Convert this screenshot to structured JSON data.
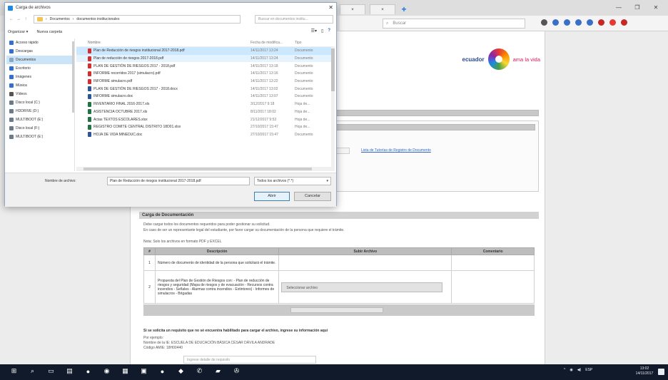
{
  "dialog": {
    "title": "Carga de archivos",
    "path": [
      "Documentos",
      "documentos institucionales"
    ],
    "search_placeholder": "Buscar en documentos institu...",
    "toolbar": {
      "organize": "Organizar ▾",
      "new_folder": "Nueva carpeta"
    },
    "nav_items": [
      {
        "label": "Acceso rápido",
        "icon": "star-icon",
        "color": "#2f6fd6"
      },
      {
        "label": "Descargas",
        "icon": "download-icon",
        "color": "#2f6fd6"
      },
      {
        "label": "Documentos",
        "icon": "documents-icon",
        "color": "#8aa6c8"
      },
      {
        "label": "Escritorio",
        "icon": "desktop-icon",
        "color": "#2f6fd6"
      },
      {
        "label": "Imágenes",
        "icon": "pictures-icon",
        "color": "#2f6fd6"
      },
      {
        "label": "Música",
        "icon": "music-icon",
        "color": "#2f6fd6"
      },
      {
        "label": "Vídeos",
        "icon": "videos-icon",
        "color": "#555555"
      },
      {
        "label": "Disco local (C:)",
        "icon": "drive-icon",
        "color": "#6b7b8c"
      },
      {
        "label": "HDDRIVE (D:)",
        "icon": "drive-icon",
        "color": "#6b7b8c"
      },
      {
        "label": "MULTIBOOT (E:)",
        "icon": "usb-icon",
        "color": "#6b7b8c"
      },
      {
        "label": "Disco local (F:)",
        "icon": "drive-icon",
        "color": "#6b7b8c"
      },
      {
        "label": "MULTIBOOT (E:)",
        "icon": "usb-icon",
        "color": "#6b7b8c"
      }
    ],
    "selected_nav": 2,
    "columns": {
      "name": "Nombre",
      "date": "Fecha de modifica...",
      "type": "Tipo"
    },
    "files": [
      {
        "name": "Plan de Reducción de riesgos institucional 2017-2018.pdf",
        "date": "14/11/2017 13:24",
        "type": "Documento",
        "icon_color": "#d32f2f"
      },
      {
        "name": "Plan de reducción de riesgos 2017-2018.pdf",
        "date": "14/11/2017 13:24",
        "type": "Documento",
        "icon_color": "#d32f2f"
      },
      {
        "name": "PLAN DE GESTIÓN DE RIESGOS 2017 - 2018.pdf",
        "date": "14/11/2017 13:18",
        "type": "Documento",
        "icon_color": "#d32f2f"
      },
      {
        "name": "INFORME recorridos 2017 (simulacro).pdf",
        "date": "14/11/2017 13:16",
        "type": "Documento",
        "icon_color": "#d32f2f"
      },
      {
        "name": "INFORME simulacro.pdf",
        "date": "14/11/2017 13:22",
        "type": "Documento",
        "icon_color": "#d32f2f"
      },
      {
        "name": "PLAN DE GESTIÓN DE RIESGOS 2017 - 2018.docx",
        "date": "14/11/2017 13:02",
        "type": "Documento",
        "icon_color": "#2b579a"
      },
      {
        "name": "INFORME simulacro.doc",
        "date": "14/11/2017 13:07",
        "type": "Documento",
        "icon_color": "#2b579a"
      },
      {
        "name": "INVENTARIO FINAL 2016-2017.xls",
        "date": "3/12/2017 9:18",
        "type": "Hoja de...",
        "icon_color": "#217346"
      },
      {
        "name": "ASISTENCIA OCTUBRE 2017.xls",
        "date": "8/11/2017 18:02",
        "type": "Hoja de...",
        "icon_color": "#217346"
      },
      {
        "name": "Actas TEXTOS ESCOLARES.xlsx",
        "date": "21/12/2017 9:53",
        "type": "Hoja de...",
        "icon_color": "#217346"
      },
      {
        "name": "REGISTRO COMITÉ CENTRAL DISTRITO 18D01.xlsx",
        "date": "27/10/2017 15:47",
        "type": "Hoja de...",
        "icon_color": "#217346"
      },
      {
        "name": "HOJA DE VIDA MINEDUC.doc",
        "date": "27/10/2017 15:47",
        "type": "Documento",
        "icon_color": "#2b579a"
      }
    ],
    "selected_file": 0,
    "hover_file": 1,
    "file_name_label": "Nombre de archivo:",
    "file_name_value": "Plan de Reducción de riesgos institucional 2017-2018.pdf",
    "filter_value": "Todos los archivos (*.*)",
    "open_label": "Abrir",
    "cancel_label": "Cancelar"
  },
  "browser": {
    "search_placeholder": "Buscar",
    "extension_colors": [
      "#555555",
      "#3a6fc9",
      "#3a6fc9",
      "#3a6fc9",
      "#3a6fc9",
      "#c62828",
      "#e53935",
      "#c62828"
    ]
  },
  "page": {
    "logo_brand": "ecuador",
    "logo_slogan": "ama la vida",
    "teacher_link": "Lista de Tutorías de Registro de Documento",
    "docs_section_title": "Carga de Documentación",
    "docs_intro_1": "Debe cargar todos los documentos requeridos para poder gestionar su solicitud.",
    "docs_intro_2": "En caso de ser un representante legal del estudiante, por favor cargar su documentación de la persona que requiere el trámite.",
    "docs_note": "Nota: Solo los archivos en formato PDF y EXCEL",
    "table_headers": {
      "num": "#",
      "description": "Descripción",
      "file": "Subir Archivo",
      "comments": "Comentario"
    },
    "doc_rows": [
      {
        "num": "1",
        "description": "Número de documento de identidad de la persona que solicitará el trámite.",
        "file_button": ""
      },
      {
        "num": "2",
        "description": "Propuesta del Plan de Gestión de Riesgos con: - Plan de reducción de riesgos y seguridad (Mapa de riesgos y de evacuación - Recursos contra incendios - Señales - Alarmas contra incendios - Extintores) - Informes de simulacros - Brigadas",
        "file_button": "Seleccionar archivo"
      }
    ],
    "bottom_note_1": "Si se solicita un requisito que no sé encuentra habilitado para cargar el archivo, ingrese su información aquí",
    "bottom_note_2": "Por ejemplo:",
    "bottom_note_3": "Nombre de la IE: ESCUELA DE EDUCACIÓN BÁSICA CÉSAR DÁVILA ANDRADE",
    "bottom_note_4": "Código AMIE: 18H00440",
    "bottom_input_placeholder": "Ingrese detalle de requisito"
  },
  "taskbar": {
    "time": "13:02",
    "date": "14/11/2017",
    "language": "ESP",
    "apps": [
      "windows-logo-icon",
      "search-icon",
      "task-view-icon",
      "file-explorer-icon",
      "firefox-icon",
      "chrome-icon",
      "store-icon",
      "photos-icon",
      "opera-icon",
      "apps-icon",
      "phone-icon",
      "folder-icon",
      "steam-icon"
    ]
  }
}
